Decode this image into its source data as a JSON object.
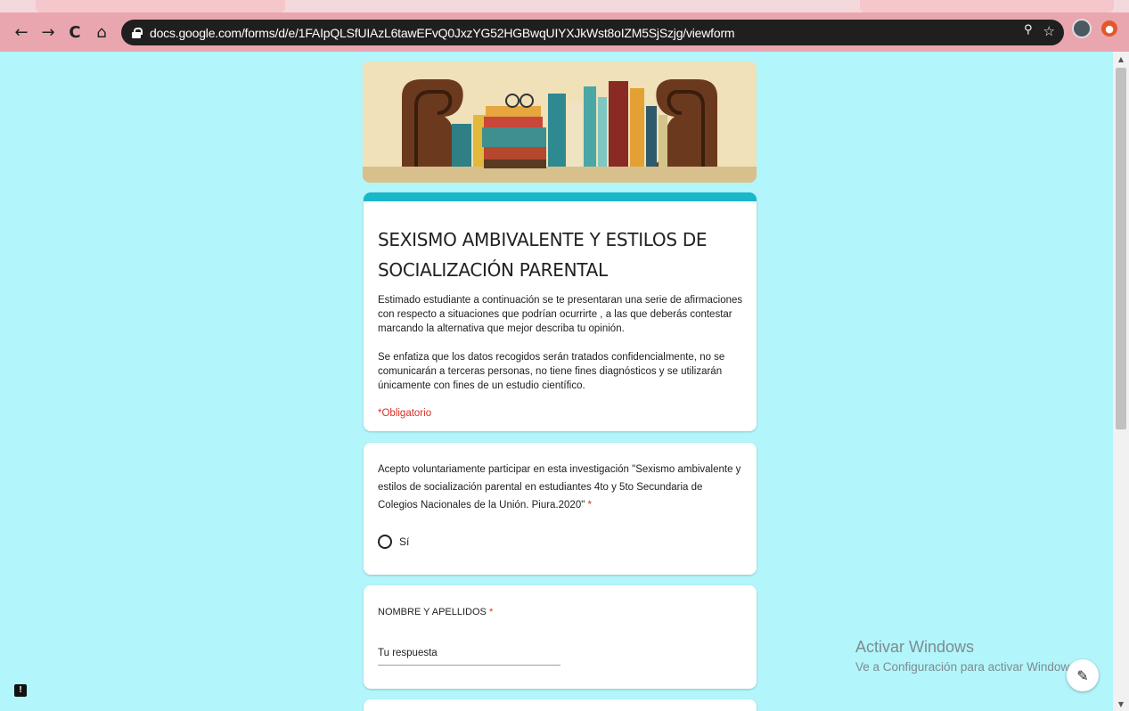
{
  "browser": {
    "url": "docs.google.com/forms/d/e/1FAIpQLSfUIAzL6tawEFvQ0JxzYG52HGBwqUIYXJkWst8oIZM5SjSzjg/viewform",
    "back": "←",
    "forward": "→",
    "reload": "C",
    "home": "⌂",
    "zoom": "🔍",
    "star": "☆"
  },
  "form": {
    "title": "SEXISMO AMBIVALENTE Y ESTILOS DE SOCIALIZACIÓN PARENTAL",
    "description_p1": "Estimado estudiante a continuación se te presentaran una serie de afirmaciones con respecto a situaciones que podrían ocurrirte , a las que deberás contestar marcando la alternativa que mejor describa tu opinión.",
    "description_p2": "Se enfatiza que los datos recogidos serán tratados confidencialmente, no se comunicarán a terceras personas, no tiene fines diagnósticos y se utilizarán únicamente con fines de un estudio científico.",
    "required_note": "*Obligatorio"
  },
  "questions": [
    {
      "text": "Acepto voluntariamente participar en esta investigación \"Sexismo ambivalente y estilos de socialización parental en estudiantes 4to y 5to Secundaria de Colegios Nacionales de la Unión. Piura.2020\"",
      "required_mark": "*",
      "option": "Sí"
    },
    {
      "text": "NOMBRE Y APELLIDOS",
      "required_mark": "*",
      "placeholder": "Tu respuesta"
    }
  ],
  "watermark": {
    "title": "Activar Windows",
    "subtitle": "Ve a Configuración para activar Windows."
  },
  "colors": {
    "page_bg": "#b2f5fb",
    "accent": "#1ab7c9",
    "required": "#d93025",
    "toolbar": "#e9a6af"
  },
  "icons": {
    "fab": "pencil-icon",
    "feedback": "feedback-icon"
  }
}
